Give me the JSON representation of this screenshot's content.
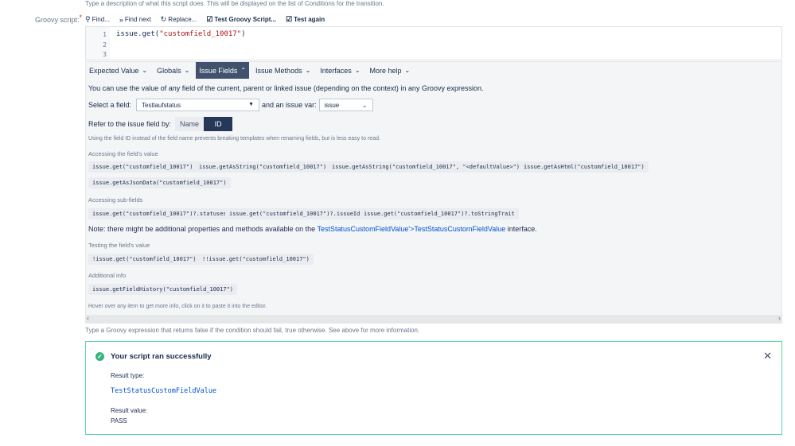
{
  "top_help": "Type a description of what this script does. This will be displayed on the list of Conditions for the transition.",
  "groovy_label": "Groovy script:",
  "required_mark": "*",
  "toolbar": {
    "find": "Find...",
    "find_next": "Find next",
    "replace": "Replace...",
    "test_script": "Test Groovy Script...",
    "test_again": "Test again"
  },
  "editor": {
    "line_numbers": [
      "1",
      "2",
      "3"
    ],
    "code_prefix": "issue.get(",
    "code_string": "\"customfield_10017\"",
    "code_suffix": ")"
  },
  "tabs": [
    {
      "label": "Expected Value",
      "active": false
    },
    {
      "label": "Globals",
      "active": false
    },
    {
      "label": "Issue Fields",
      "active": true
    },
    {
      "label": "Issue Methods",
      "active": false
    },
    {
      "label": "Interfaces",
      "active": false
    },
    {
      "label": "More help",
      "active": false
    }
  ],
  "panel": {
    "intro": "You can use the value of any field of the current, parent or linked issue (depending on the context) in any Groovy expression.",
    "select_field_label": "Select a field:",
    "select_field_value": "Testlaufstatus",
    "issue_var_label": "and an issue var:",
    "issue_var_value": "issue",
    "refer_label": "Refer to the issue field by:",
    "seg_name": "Name",
    "seg_id": "ID",
    "id_note": "Using the field ID instead of the field name prevents breaking templates when renaming fields, but is less easy to read.",
    "accessing_value_title": "Accessing the field's value",
    "accessing_value_chips": [
      "issue.get(\"customfield_10017\")",
      "issue.getAsString(\"customfield_10017\")",
      "issue.getAsString(\"customfield_10017\", \"<defaultValue>\")",
      "issue.getAsHtml(\"customfield_10017\")",
      "issue.getAsJsonData(\"customfield_10017\")"
    ],
    "sub_fields_title": "Accessing sub-fields",
    "sub_fields_chips": [
      "issue.get(\"customfield_10017\")?.statuses",
      "issue.get(\"customfield_10017\")?.issueId",
      "issue.get(\"customfield_10017\")?.toStringTrait"
    ],
    "note_prefix": "Note: there might be additional properties and methods available on the ",
    "note_link1": "TestStatusCustomFieldValue'>TestStatusCustomFieldValue",
    "note_suffix": " interface.",
    "testing_title": "Testing the field's value",
    "testing_chips": [
      "!issue.get(\"customfield_10017\")",
      "!!issue.get(\"customfield_10017\")"
    ],
    "additional_title": "Additional info",
    "additional_chips": [
      "issue.getFieldHistory(\"customfield_10017\")"
    ],
    "hover_note": "Hover over any item to get more info, click on it to paste it into the editor."
  },
  "bottom_help": "Type a Groovy expression that returns false if the condition should fail, true otherwise. See above for more information.",
  "result": {
    "title": "Your script ran successfully",
    "type_label": "Result type:",
    "type_value": "TestStatusCustomFieldValue",
    "value_label": "Result value:",
    "value_value": "PASS"
  },
  "colors": {
    "active_tab": "#42526e",
    "success_border": "#57d9a3",
    "success_icon": "#36b37e",
    "link": "#0052cc"
  }
}
